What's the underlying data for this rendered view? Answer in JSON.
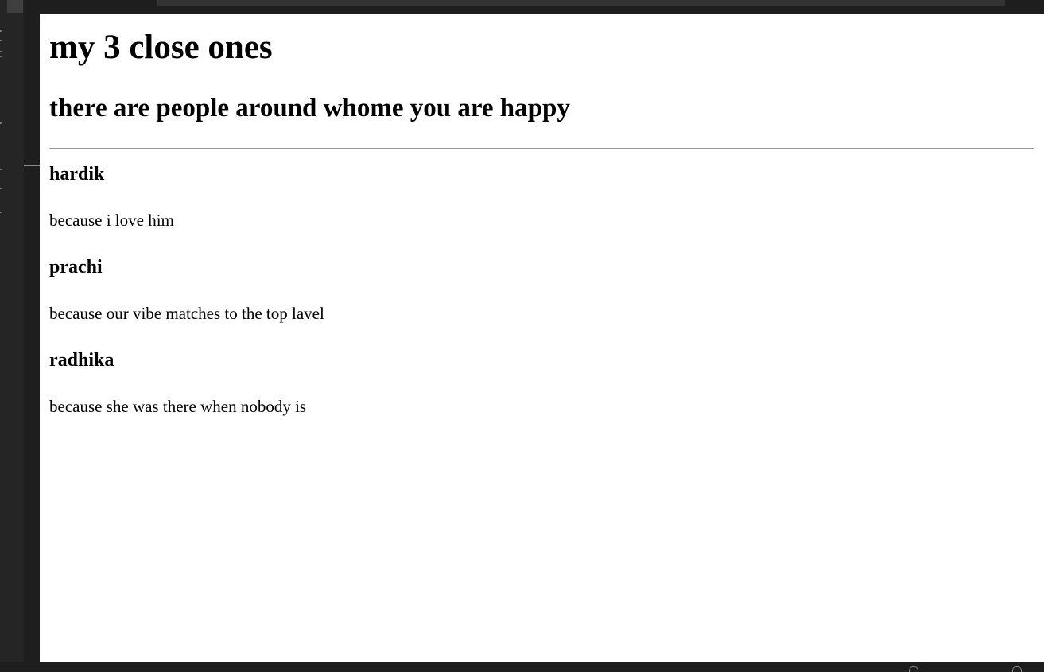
{
  "page": {
    "title": "my 3 close ones",
    "subtitle": "there are people around whome you are happy"
  },
  "people": [
    {
      "name": "hardik",
      "reason": "because i love him"
    },
    {
      "name": "prachi",
      "reason": "because our vibe matches to the top lavel"
    },
    {
      "name": "radhika",
      "reason": "because she was there when nobody is"
    }
  ],
  "colors": {
    "editor_background": "#1e1e1e",
    "preview_background": "#ffffff",
    "text": "#000000",
    "divider": "#9a9a9a"
  },
  "icons": {
    "status_left": "notification-icon",
    "status_right": "account-icon"
  }
}
